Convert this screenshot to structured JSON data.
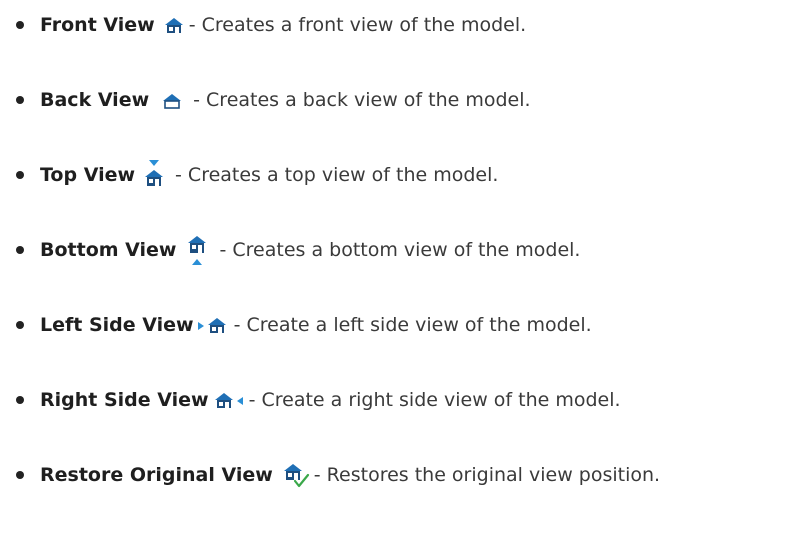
{
  "colors": {
    "icon_blue": "#1f6fb5",
    "icon_dark": "#1e4f80",
    "check_green": "#3aa84a"
  },
  "items": [
    {
      "name": "Front View",
      "icon": "house-front-icon",
      "description": "- Creates a front view of the model."
    },
    {
      "name": "Back View",
      "icon": "house-back-icon",
      "description": "- Creates a back view of the model."
    },
    {
      "name": "Top View",
      "icon": "house-top-icon",
      "description": "- Creates a top view of the model."
    },
    {
      "name": "Bottom View",
      "icon": "house-bottom-icon",
      "description": "- Creates a bottom view of the model."
    },
    {
      "name": "Left Side View",
      "icon": "house-left-side-icon",
      "description": "- Create a left side view of the model."
    },
    {
      "name": "Right Side View",
      "icon": "house-right-side-icon",
      "description": "- Create a right side view of the model."
    },
    {
      "name": "Restore Original View",
      "icon": "house-restore-icon",
      "description": "- Restores the original view position."
    }
  ]
}
